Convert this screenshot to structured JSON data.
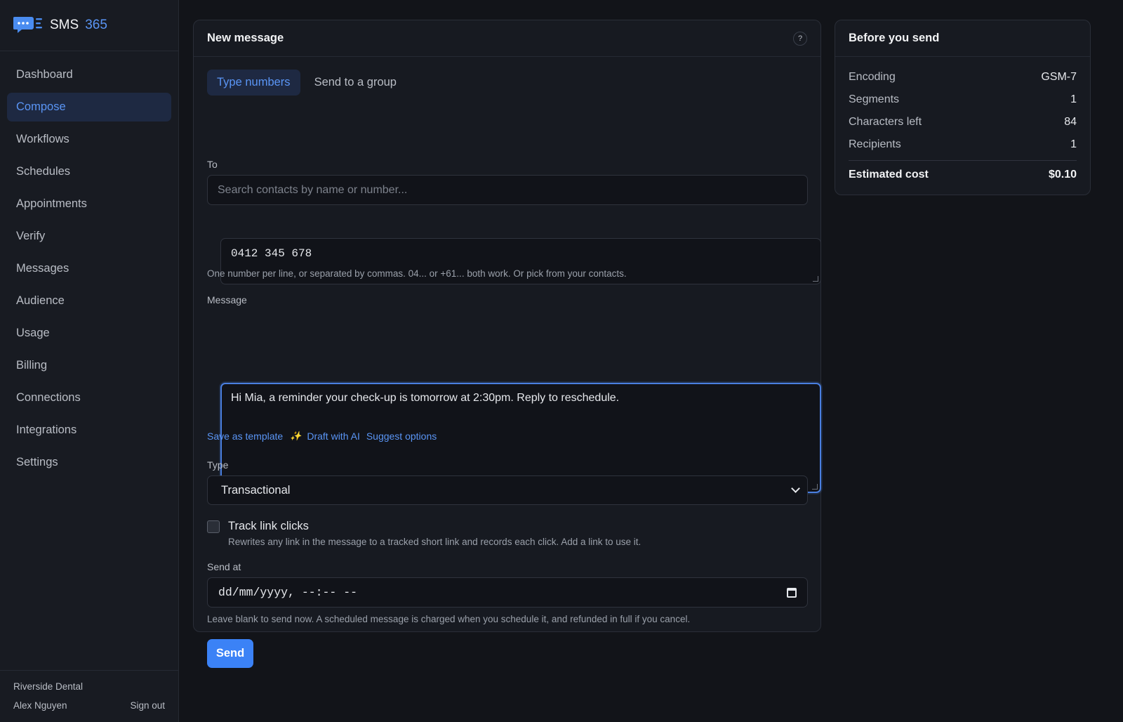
{
  "brand": {
    "name": "SMS",
    "number": "365"
  },
  "nav": {
    "items": [
      {
        "label": "Dashboard",
        "active": false
      },
      {
        "label": "Compose",
        "active": true
      },
      {
        "label": "Workflows",
        "active": false
      },
      {
        "label": "Schedules",
        "active": false
      },
      {
        "label": "Appointments",
        "active": false
      },
      {
        "label": "Verify",
        "active": false
      },
      {
        "label": "Messages",
        "active": false
      },
      {
        "label": "Audience",
        "active": false
      },
      {
        "label": "Usage",
        "active": false
      },
      {
        "label": "Billing",
        "active": false
      },
      {
        "label": "Connections",
        "active": false
      },
      {
        "label": "Integrations",
        "active": false
      },
      {
        "label": "Settings",
        "active": false
      }
    ]
  },
  "footer": {
    "org": "Riverside Dental",
    "user": "Alex Nguyen",
    "signout": "Sign out"
  },
  "compose": {
    "title": "New message",
    "help": "?",
    "tabs": [
      {
        "label": "Type numbers",
        "active": true
      },
      {
        "label": "Send to a group",
        "active": false
      }
    ],
    "to_label": "To",
    "search_placeholder": "Search contacts by name or number...",
    "numbers_value": "0412 345 678",
    "numbers_hint": "One number per line, or separated by commas. 04... or +61... both work. Or pick from your contacts.",
    "message_label": "Message",
    "message_value": "Hi Mia, a reminder your check-up is tomorrow at 2:30pm. Reply to reschedule.",
    "save_template": "Save as template",
    "draft_ai": "Draft with AI",
    "suggest": "Suggest options",
    "type_label": "Type",
    "type_value": "Transactional",
    "track_label": "Track link clicks",
    "track_hint": "Rewrites any link in the message to a tracked short link and records each click. Add a link to use it.",
    "sendat_label": "Send at",
    "sendat_placeholder": "dd/mm/yyyy, --:-- --",
    "sendat_hint": "Leave blank to send now. A scheduled message is charged when you schedule it, and refunded in full if you cancel.",
    "send_button": "Send"
  },
  "summary": {
    "title": "Before you send",
    "rows": [
      {
        "label": "Encoding",
        "value": "GSM-7"
      },
      {
        "label": "Segments",
        "value": "1"
      },
      {
        "label": "Characters left",
        "value": "84"
      },
      {
        "label": "Recipients",
        "value": "1"
      }
    ],
    "total_label": "Estimated cost",
    "total_value": "$0.10"
  },
  "colors": {
    "accent": "#3b82f6",
    "link": "#5a95f5",
    "background": "#121419",
    "card": "#171a21"
  }
}
